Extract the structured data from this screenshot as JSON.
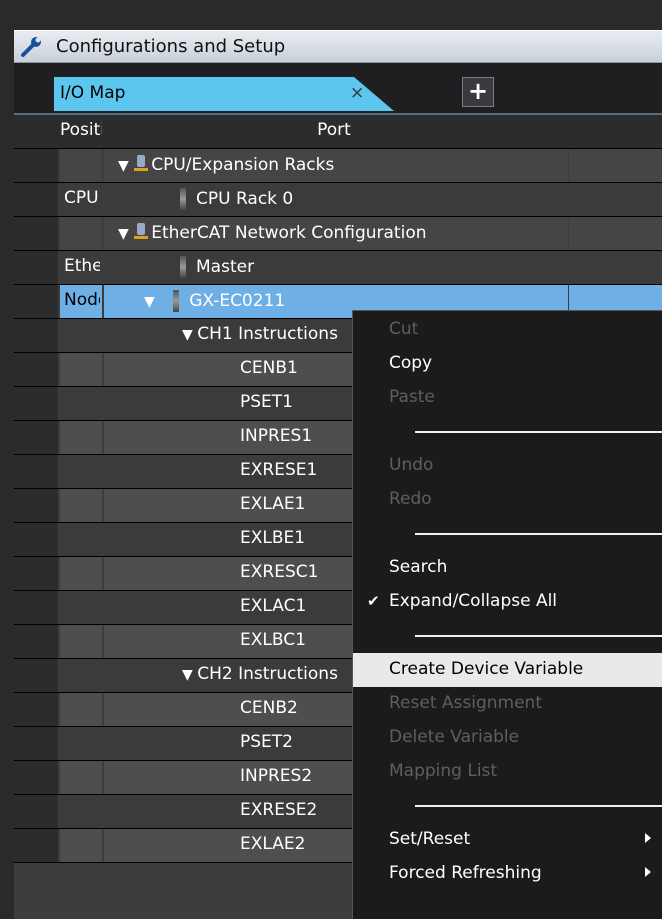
{
  "window": {
    "title": "Configurations and Setup"
  },
  "tabs": {
    "active_label": "I/O Map",
    "close_glyph": "×",
    "add_glyph": "+"
  },
  "grid": {
    "columns": {
      "position": "Position",
      "port": "Port"
    },
    "rows": [
      {
        "position": "",
        "port": "CPU/Expansion Racks",
        "kind": "group",
        "expanded": true
      },
      {
        "position": "CPU",
        "port": "CPU Rack 0",
        "kind": "rack"
      },
      {
        "position": "",
        "port": "EtherCAT Network Configuration",
        "kind": "group",
        "expanded": true
      },
      {
        "position": "EtherCAT",
        "port": "Master",
        "kind": "rack"
      },
      {
        "position": "Node",
        "port": "GX-EC0211",
        "kind": "device",
        "expanded": true,
        "selected": true
      },
      {
        "position": "",
        "port": "CH1 Instructions",
        "kind": "sub",
        "expanded": true
      },
      {
        "position": "",
        "port": "CENB1",
        "kind": "var"
      },
      {
        "position": "",
        "port": "PSET1",
        "kind": "var"
      },
      {
        "position": "",
        "port": "INPRES1",
        "kind": "var"
      },
      {
        "position": "",
        "port": "EXRESE1",
        "kind": "var"
      },
      {
        "position": "",
        "port": "EXLAE1",
        "kind": "var"
      },
      {
        "position": "",
        "port": "EXLBE1",
        "kind": "var"
      },
      {
        "position": "",
        "port": "EXRESC1",
        "kind": "var"
      },
      {
        "position": "",
        "port": "EXLAC1",
        "kind": "var"
      },
      {
        "position": "",
        "port": "EXLBC1",
        "kind": "var"
      },
      {
        "position": "",
        "port": "CH2 Instructions",
        "kind": "sub",
        "expanded": true
      },
      {
        "position": "",
        "port": "CENB2",
        "kind": "var"
      },
      {
        "position": "",
        "port": "PSET2",
        "kind": "var"
      },
      {
        "position": "",
        "port": "INPRES2",
        "kind": "var"
      },
      {
        "position": "",
        "port": "EXRESE2",
        "kind": "var"
      },
      {
        "position": "",
        "port": "EXLAE2",
        "kind": "var"
      }
    ]
  },
  "context_menu": {
    "items": [
      {
        "label": "Cut",
        "enabled": false
      },
      {
        "label": "Copy",
        "enabled": true
      },
      {
        "label": "Paste",
        "enabled": false
      },
      {
        "separator": true
      },
      {
        "label": "Undo",
        "enabled": false
      },
      {
        "label": "Redo",
        "enabled": false
      },
      {
        "separator": true
      },
      {
        "label": "Search",
        "enabled": true
      },
      {
        "label": "Expand/Collapse All",
        "enabled": true,
        "checked": true
      },
      {
        "separator": true
      },
      {
        "label": "Create Device Variable",
        "enabled": true,
        "highlighted": true
      },
      {
        "label": "Reset Assignment",
        "enabled": false
      },
      {
        "label": "Delete Variable",
        "enabled": false
      },
      {
        "label": "Mapping List",
        "enabled": false
      },
      {
        "separator": true
      },
      {
        "label": "Set/Reset",
        "enabled": true,
        "submenu": true
      },
      {
        "label": "Forced Refreshing",
        "enabled": true,
        "submenu": true
      }
    ]
  },
  "colors": {
    "selection": "#6eb0e6",
    "menu_bg": "#1b1b1b",
    "menu_highlight": "#e9e9e9",
    "disabled_text": "#5f5f5f"
  },
  "icons": {
    "window": "wrench-icon",
    "group": "device-tree-icon",
    "rack": "rack-icon",
    "check": "checkmark-icon",
    "submenu": "submenu-arrow-icon"
  }
}
